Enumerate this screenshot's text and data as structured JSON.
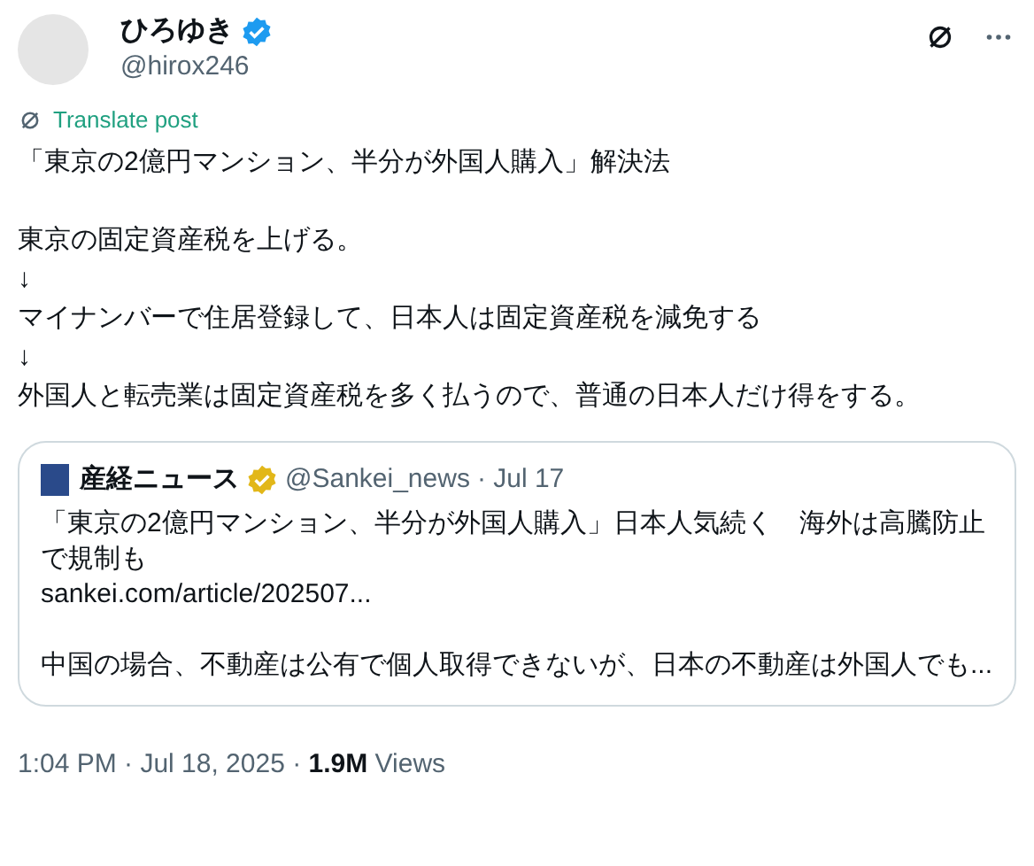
{
  "author": {
    "name": "ひろゆき",
    "handle": "@hirox246",
    "verified": true
  },
  "translate": "Translate post",
  "body_paragraphs": [
    [
      "「東京の2億円マンション、半分が外国人購入」解決法"
    ],
    [
      "東京の固定資産税を上げる。",
      "↓",
      "マイナンバーで住居登録して、日本人は固定資産税を減免する",
      "↓",
      "外国人と転売業は固定資産税を多く払うので、普通の日本人だけ得をする。"
    ]
  ],
  "quote": {
    "name": "産経ニュース",
    "verified": true,
    "handle": "@Sankei_news",
    "date": "· Jul 17",
    "headline": "「東京の2億円マンション、半分が外国人購入」日本人気続く　海外は高騰防止で規制も",
    "link": "sankei.com/article/202507...",
    "excerpt": "中国の場合、不動産は公有で個人取得できないが、日本の不動産は外国人でも..."
  },
  "footer": "1:04 PM · Jul 18, 2025 · **1.9M** Views"
}
